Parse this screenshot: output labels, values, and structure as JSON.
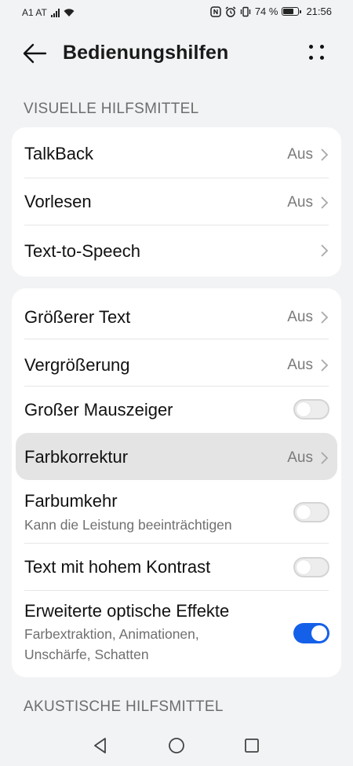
{
  "status_bar": {
    "carrier": "A1 AT",
    "battery": "74 %",
    "battery_level": 0.74,
    "time": "21:56"
  },
  "header": {
    "title": "Bedienungshilfen"
  },
  "sections": {
    "visual": {
      "title": "VISUELLE HILFSMITTEL",
      "items": [
        {
          "label": "TalkBack",
          "value": "Aus"
        },
        {
          "label": "Vorlesen",
          "value": "Aus"
        },
        {
          "label": "Text-to-Speech",
          "value": ""
        }
      ]
    },
    "display": {
      "items": [
        {
          "label": "Größerer Text",
          "value": "Aus"
        },
        {
          "label": "Vergrößerung",
          "value": "Aus"
        },
        {
          "label": "Großer Mauszeiger",
          "toggle": false
        },
        {
          "label": "Farbkorrektur",
          "value": "Aus"
        },
        {
          "label": "Farbumkehr",
          "subtitle": "Kann die Leistung beeinträchtigen",
          "toggle": false
        },
        {
          "label": "Text mit hohem Kontrast",
          "toggle": false
        },
        {
          "label": "Erweiterte optische Effekte",
          "subtitle_line1": "Farbextraktion, Animationen,",
          "subtitle_line2": "Unschärfe, Schatten",
          "toggle": true
        }
      ]
    },
    "acoustic": {
      "title": "AKUSTISCHE HILFSMITTEL"
    }
  },
  "colors": {
    "accent": "#1560e8",
    "background": "#f1f3f5",
    "highlight": "#e4e4e4"
  },
  "icons": [
    "signal-icon",
    "wifi-icon",
    "nfc-icon",
    "alarm-icon",
    "vibrate-icon",
    "battery-icon",
    "back-arrow-icon",
    "more-options-icon",
    "chevron-right-icon",
    "nav-back-icon",
    "nav-home-icon",
    "nav-recents-icon"
  ]
}
